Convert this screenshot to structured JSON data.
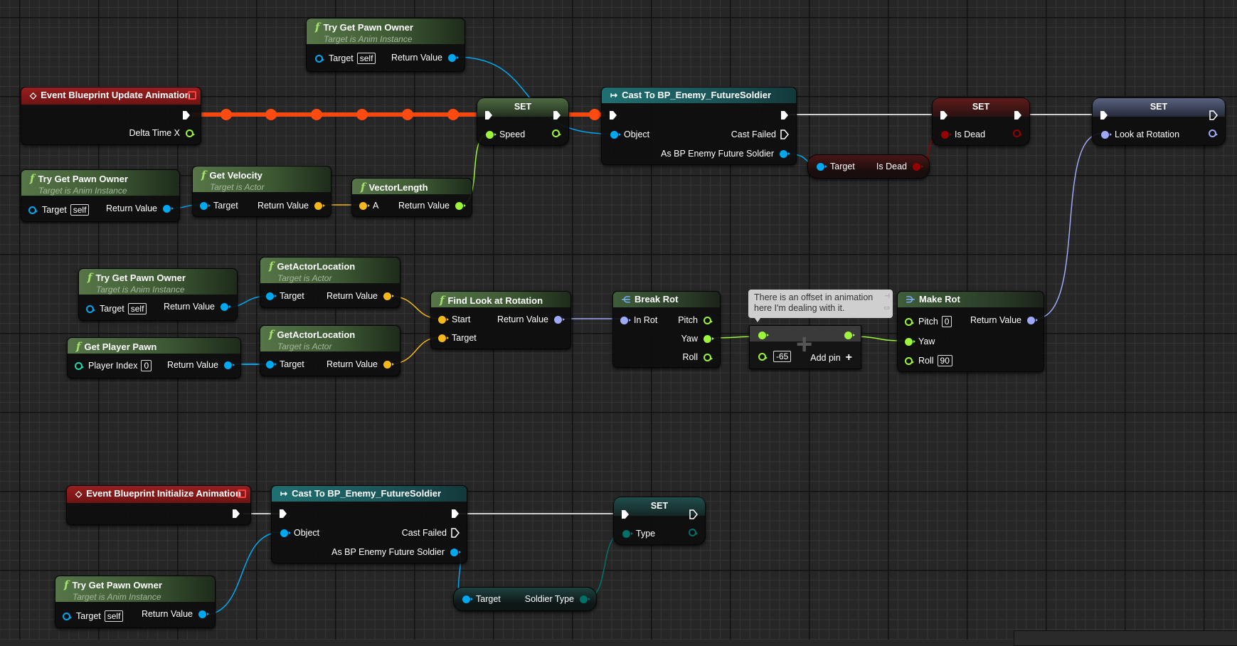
{
  "colors": {
    "exec": "#ffffff",
    "object": "#00a8f0",
    "float": "#9cf53a",
    "vector": "#f5b81c",
    "rotator": "#9eaaf7",
    "bool": "#950000",
    "enum": "#00706b",
    "event": "#8a1a1a",
    "cast": "#1d6b6d",
    "func": "#4d6b42"
  },
  "nodes": {
    "pawn_owner_top": {
      "title": "Try Get Pawn Owner",
      "subtitle": "Target is Anim Instance",
      "in": "Target",
      "in_default": "self",
      "out": "Return Value"
    },
    "update_event": {
      "title": "Event Blueprint Update Animation",
      "out": "Delta Time X"
    },
    "set_speed": {
      "title": "SET",
      "pin": "Speed"
    },
    "cast_top": {
      "title": "Cast To BP_Enemy_FutureSoldier",
      "in": "Object",
      "failed": "Cast Failed",
      "out": "As BP Enemy Future Soldier"
    },
    "set_isdead": {
      "title": "SET",
      "pin": "Is Dead"
    },
    "get_isdead": {
      "in": "Target",
      "out": "Is Dead"
    },
    "set_lookat": {
      "title": "SET",
      "pin": "Look at Rotation"
    },
    "pawn_owner_mid": {
      "title": "Try Get Pawn Owner",
      "subtitle": "Target is Anim Instance",
      "in": "Target",
      "in_default": "self",
      "out": "Return Value"
    },
    "get_velocity": {
      "title": "Get Velocity",
      "subtitle": "Target is Actor",
      "in": "Target",
      "out": "Return Value"
    },
    "vector_length": {
      "title": "VectorLength",
      "in": "A",
      "out": "Return Value"
    },
    "pawn_owner_loc": {
      "title": "Try Get Pawn Owner",
      "subtitle": "Target is Anim Instance",
      "in": "Target",
      "in_default": "self",
      "out": "Return Value"
    },
    "actor_loc_1": {
      "title": "GetActorLocation",
      "subtitle": "Target is Actor",
      "in": "Target",
      "out": "Return Value"
    },
    "get_player_pawn": {
      "title": "Get Player Pawn",
      "in": "Player Index",
      "in_default": "0",
      "out": "Return Value"
    },
    "actor_loc_2": {
      "title": "GetActorLocation",
      "subtitle": "Target is Actor",
      "in": "Target",
      "out": "Return Value"
    },
    "find_look": {
      "title": "Find Look at Rotation",
      "in1": "Start",
      "in2": "Target",
      "out": "Return Value"
    },
    "break_rot": {
      "title": "Break Rot",
      "in": "In Rot",
      "out1": "Pitch",
      "out2": "Yaw",
      "out3": "Roll"
    },
    "add_node": {
      "in_default": "-65",
      "add_pin": "Add pin"
    },
    "comment": {
      "text": "There is an offset in animation here I'm dealing with it."
    },
    "make_rot": {
      "title": "Make Rot",
      "in1": "Pitch",
      "in1_default": "0",
      "in2": "Yaw",
      "in3": "Roll",
      "in3_default": "90",
      "out": "Return Value"
    },
    "init_event": {
      "title": "Event Blueprint Initialize Animation"
    },
    "cast_bottom": {
      "title": "Cast To BP_Enemy_FutureSoldier",
      "in": "Object",
      "failed": "Cast Failed",
      "out": "As BP Enemy Future Soldier"
    },
    "set_type": {
      "title": "SET",
      "pin": "Type"
    },
    "get_soldier_type": {
      "in": "Target",
      "out": "Soldier Type"
    },
    "pawn_owner_bottom": {
      "title": "Try Get Pawn Owner",
      "subtitle": "Target is Anim Instance",
      "in": "Target",
      "in_default": "self",
      "out": "Return Value"
    }
  }
}
